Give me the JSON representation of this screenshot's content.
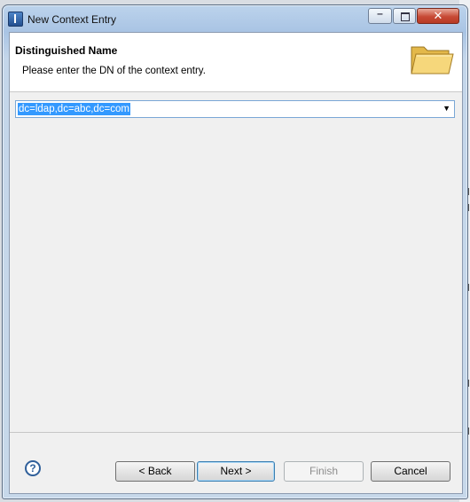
{
  "window": {
    "title": "New Context Entry",
    "controls": {
      "minimize": "–",
      "close": "✕"
    }
  },
  "banner": {
    "title": "Distinguished Name",
    "message": "Please enter the DN of the context entry.",
    "icon": "folder-icon"
  },
  "dn_field": {
    "value": "dc=ldap,dc=abc,dc=com",
    "dropdown_arrow": "▼"
  },
  "buttons": {
    "help": "?",
    "back": "< Back",
    "next": "Next >",
    "finish": "Finish",
    "cancel": "Cancel"
  },
  "colors": {
    "selection": "#3399ff",
    "close_button": "#c74a35",
    "content_bg": "#f0f0f0"
  }
}
